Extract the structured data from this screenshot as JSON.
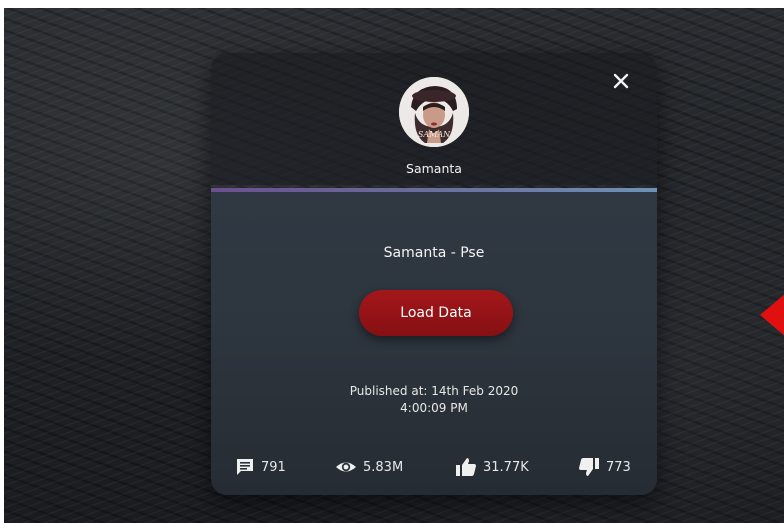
{
  "card": {
    "username": "Samanta",
    "avatar_caption": "SAMAN",
    "title": "Samanta - Pse",
    "load_button_label": "Load Data",
    "published_line1": "Published at: 14th Feb 2020",
    "published_line2": "4:00:09 PM"
  },
  "stats": {
    "comments": "791",
    "views": "5.83M",
    "likes": "31.77K",
    "dislikes": "773"
  },
  "icons": {
    "close": "close-icon",
    "comments": "comment-icon",
    "views": "eye-icon",
    "likes": "thumbs-up-icon",
    "dislikes": "thumbs-down-icon"
  },
  "colors": {
    "button": "#9a1518",
    "divider_start": "#6a4f8f",
    "divider_end": "#6f91b5",
    "marker": "#e01010"
  }
}
